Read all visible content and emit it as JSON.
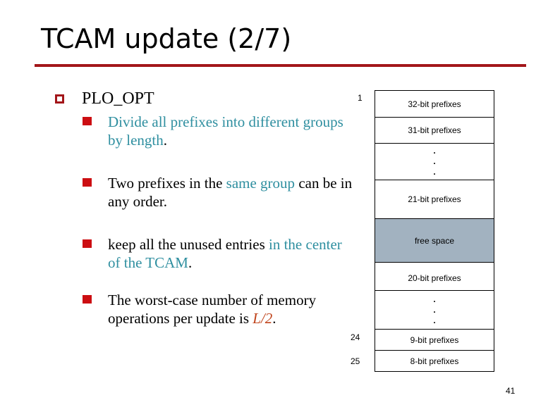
{
  "slide": {
    "title": "TCAM update (2/7)",
    "accent_color": "#a3161a",
    "page_number": "41"
  },
  "content": {
    "heading": "PLO_OPT",
    "bullets": [
      {
        "parts": [
          {
            "text": "Divide all prefixes into different groups by length",
            "style": "teal"
          },
          {
            "text": ".",
            "style": "plain"
          }
        ]
      },
      {
        "parts": [
          {
            "text": "Two prefixes in the ",
            "style": "plain"
          },
          {
            "text": "same group",
            "style": "teal"
          },
          {
            "text": " can be in any order.",
            "style": "plain"
          }
        ]
      },
      {
        "parts": [
          {
            "text": "keep all the unused entries ",
            "style": "plain"
          },
          {
            "text": "in the center of the TCAM",
            "style": "teal"
          },
          {
            "text": ".",
            "style": "plain"
          }
        ]
      },
      {
        "parts": [
          {
            "text": "The worst-case number of memory operations per update is ",
            "style": "plain"
          },
          {
            "text": "L/2",
            "style": "red-italic"
          },
          {
            "text": ".",
            "style": "plain"
          }
        ]
      }
    ]
  },
  "tcam": {
    "index_labels": {
      "top": "1",
      "row_9bit": "24",
      "row_8bit": "25"
    },
    "rows": [
      {
        "label": "32-bit prefixes",
        "kind": "prefix"
      },
      {
        "label": "31-bit prefixes",
        "kind": "prefix"
      },
      {
        "label": ". . .",
        "kind": "ellipsis"
      },
      {
        "label": "21-bit prefixes",
        "kind": "prefix"
      },
      {
        "label": "free space",
        "kind": "free"
      },
      {
        "label": "20-bit prefixes",
        "kind": "prefix"
      },
      {
        "label": ". . .",
        "kind": "ellipsis"
      },
      {
        "label": "9-bit prefixes",
        "kind": "prefix"
      },
      {
        "label": "8-bit prefixes",
        "kind": "prefix"
      }
    ],
    "free_color": "#a2b2c0"
  }
}
